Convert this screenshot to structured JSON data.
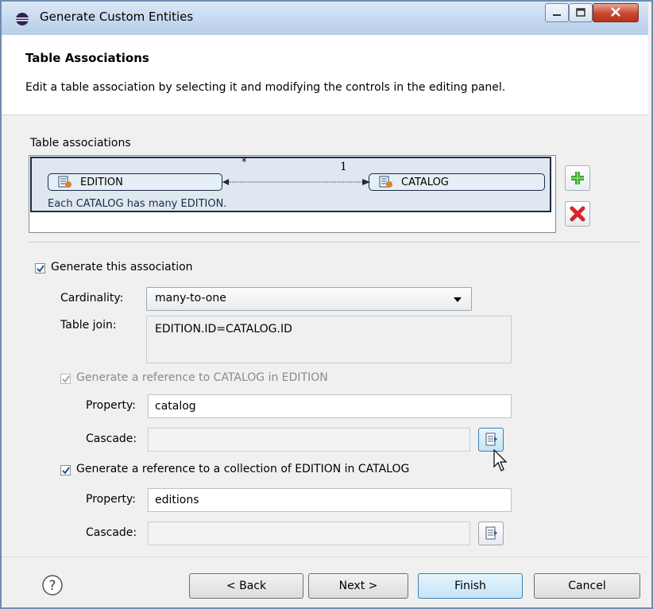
{
  "window": {
    "title": "Generate Custom Entities",
    "controls": {
      "minimize_icon": "minimize-icon",
      "maximize_icon": "maximize-icon",
      "close_icon": "close-icon"
    }
  },
  "header": {
    "title": "Table Associations",
    "description": "Edit a table association by selecting it and modifying the controls in the editing panel."
  },
  "associations": {
    "label": "Table associations",
    "items": [
      {
        "source": "EDITION",
        "target": "CATALOG",
        "source_multiplicity": "*",
        "target_multiplicity": "1",
        "description": "Each CATALOG has many EDITION."
      }
    ],
    "add_icon": "plus-icon",
    "remove_icon": "delete-x-icon"
  },
  "editor": {
    "generate_label": "Generate this association",
    "generate_checked": true,
    "cardinality_label": "Cardinality:",
    "cardinality_value": "many-to-one",
    "table_join_label": "Table join:",
    "table_join_value": "EDITION.ID=CATALOG.ID",
    "ref1": {
      "label": "Generate a reference to CATALOG in EDITION",
      "checked": true,
      "enabled": false,
      "property_label": "Property:",
      "property_value": "catalog",
      "cascade_label": "Cascade:",
      "cascade_value": ""
    },
    "ref2": {
      "label": "Generate a reference to a collection of EDITION in CATALOG",
      "checked": true,
      "enabled": true,
      "property_label": "Property:",
      "property_value": "editions",
      "cascade_label": "Cascade:",
      "cascade_value": ""
    }
  },
  "footer": {
    "help_icon": "help-icon",
    "back": "< Back",
    "next": "Next >",
    "finish": "Finish",
    "cancel": "Cancel"
  },
  "colors": {
    "selection_border": "#1b2a45",
    "selection_fill": "#dfe8f1",
    "add_green": "#3fa535",
    "remove_red": "#d8232a",
    "default_button": "#3c7fb1"
  }
}
